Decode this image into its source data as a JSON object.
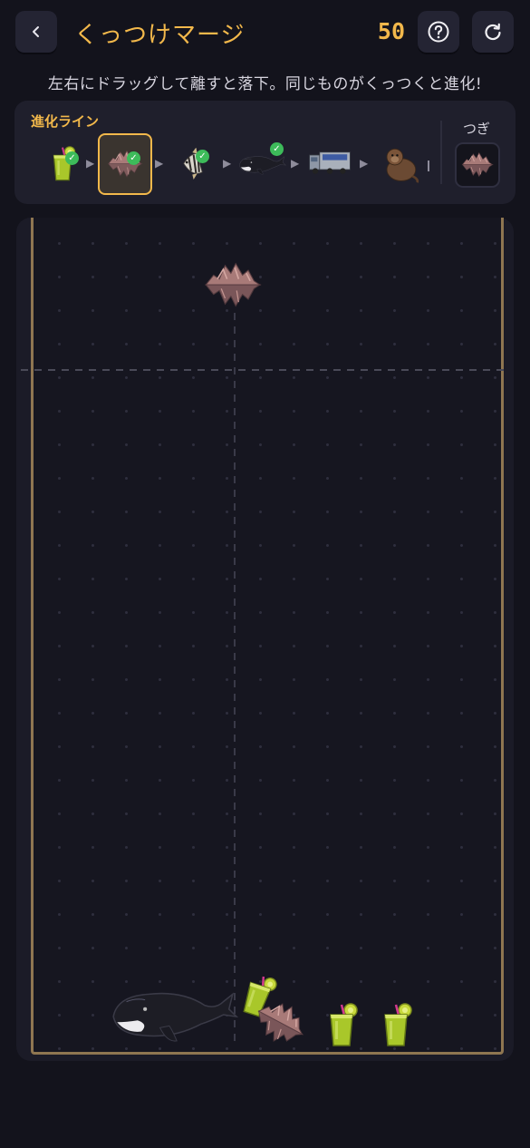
{
  "header": {
    "title": "くっつけマージ",
    "score": "50",
    "back_icon": "chevron-left-icon",
    "help_icon": "question-circle-icon",
    "reset_icon": "refresh-icon"
  },
  "instruction": "左右にドラッグして離すと落下。同じものがくっつくと進化!",
  "evolution": {
    "label": "進化ライン",
    "items": [
      {
        "name": "green-smoothie",
        "unlocked": true
      },
      {
        "name": "coral-rock",
        "unlocked": true,
        "current": true
      },
      {
        "name": "angelfish",
        "unlocked": true
      },
      {
        "name": "whale",
        "unlocked": true
      },
      {
        "name": "truck",
        "unlocked": false
      },
      {
        "name": "monkey",
        "unlocked": false
      }
    ]
  },
  "next": {
    "label": "つぎ",
    "item": "coral-rock"
  },
  "colors": {
    "accent": "#f2b84b",
    "check": "#3dbb5a",
    "board_border": "#8f7651"
  }
}
